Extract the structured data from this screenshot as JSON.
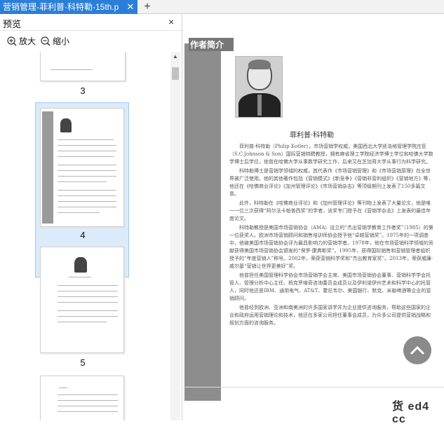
{
  "tab": {
    "title": "营销管理-菲利普·科特勒-15th.p",
    "close_glyph": "✕",
    "new_glyph": "+"
  },
  "sidebar": {
    "title": "预览",
    "close_glyph": "×",
    "zoom_in_label": "放大",
    "zoom_out_label": "缩小",
    "pages": [
      {
        "number": "3"
      },
      {
        "number": "4",
        "selected": true
      },
      {
        "number": "5"
      }
    ]
  },
  "document": {
    "section_label": "作者简介",
    "author_name": "菲利普·科特勒",
    "paragraphs": [
      "菲利普·科特勒（Philip Kotler），市场营销学权威，美国西北大学凯洛格管理学院庄臣（S.C.Johnson & Son）国际营销特聘教授，拥有麻省理工学院经济学博士学位和哈佛大学数学博士后学位，他曾在哈佛大学从事数学研究工作，后来又在芝加哥大学从事行为科学研究。",
      "科特勒博士是营销学领域的权威，其代表作《市场营销管理》和《市场营销原理》在全世界被广泛使用。他的其他著作包括《营销模式》《新竞争》《营销非营利组织》《营销地方》等，他还在《哈佛商业评论》《加州管理评论》《市场营销杂志》等顶级期刊上发表了150多篇文章。",
      "此外，科特勒在《哈佛商业评论》和《加州管理评论》等刊物上发表了大量论文，他是唯一一位三次获得“阿尔法卡帕普西奖”的学者，该奖专门授予在《营销学杂志》上发表的最佳年度论文。",
      "科特勒教授是美国市场营销协会（AMA）设立的“杰出营销学教育工作者奖”（1985）的第一位获奖人。欧洲市场营销顾问和销售培训师协会授予他“卓越营销奖”。1975年的一项调查中，他被美国市场营销协会评为最具影响力的营销学者。1978年，他在市场营销科学领域的贡献获得美国市场营销协会颁发的“保罗·康弗斯奖”。1995年，获得国际销售和营销管理者组织授予的“年度营销人”称号。2002年，荣获营销科学奖和“杰出教育家奖”。2013年，荣获威廉·威尔基“营销让世界更美好”奖。",
      "他曾担任美国管理科学协会市场营销学会主席、美国市场营销协会董事、营销科学学会托管人、管理分析中心主任、杨克罗维奇咨询委员会成员以及伊利诺伊州艺术和科学中心的托管人，同时他还是IBM、通用电气、AT&T、霍尼韦尔、美国银行、默克、米勒啤酒等企业的营销顾问。",
      "他曾经到欧洲、亚洲和南美洲的许多国家讲学并为企业提供咨询服务，帮助这些国家的企业和政府运用营销理论和技术，他还在多家公司担任董事会成员，为众多公司提供营销战略和规划方面的咨询服务。"
    ],
    "watermark": "货 ed4 cc"
  }
}
